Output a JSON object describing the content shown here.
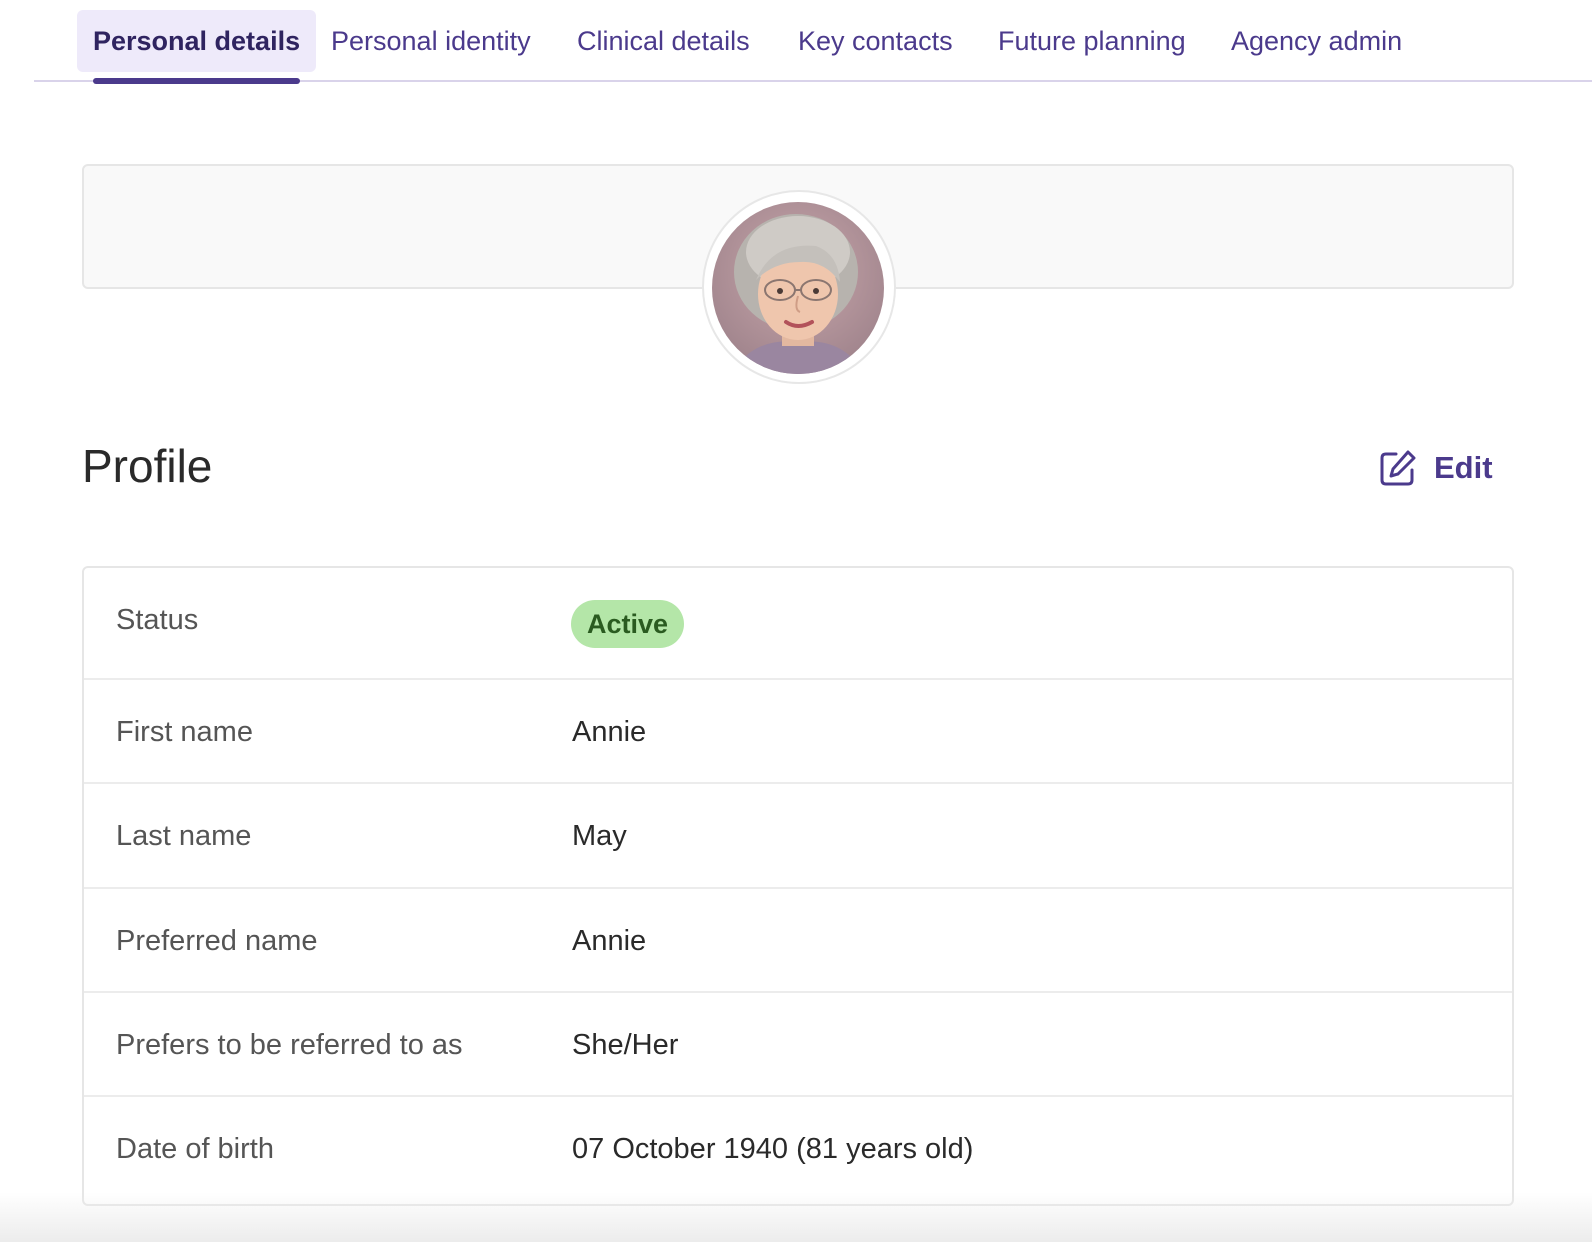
{
  "tabs": [
    {
      "label": "Personal details",
      "active": true
    },
    {
      "label": "Personal identity",
      "active": false
    },
    {
      "label": "Clinical details",
      "active": false
    },
    {
      "label": "Key contacts",
      "active": false
    },
    {
      "label": "Future planning",
      "active": false
    },
    {
      "label": "Agency admin",
      "active": false
    }
  ],
  "profile": {
    "title": "Profile",
    "edit_label": "Edit",
    "edit_icon": "edit-icon"
  },
  "details": {
    "status": {
      "label": "Status",
      "value": "Active"
    },
    "first_name": {
      "label": "First name",
      "value": "Annie"
    },
    "last_name": {
      "label": "Last name",
      "value": "May"
    },
    "preferred_name": {
      "label": "Preferred name",
      "value": "Annie"
    },
    "pronouns": {
      "label": "Prefers to be referred to as",
      "value": "She/Her"
    },
    "dob": {
      "label": "Date of birth",
      "value": "07 October 1940 (81 years old)"
    }
  },
  "colors": {
    "accent": "#4b3a8c",
    "active_tab_bg": "#eeeafa",
    "status_badge_bg": "#b4e6a8",
    "status_badge_text": "#2a5b20"
  }
}
